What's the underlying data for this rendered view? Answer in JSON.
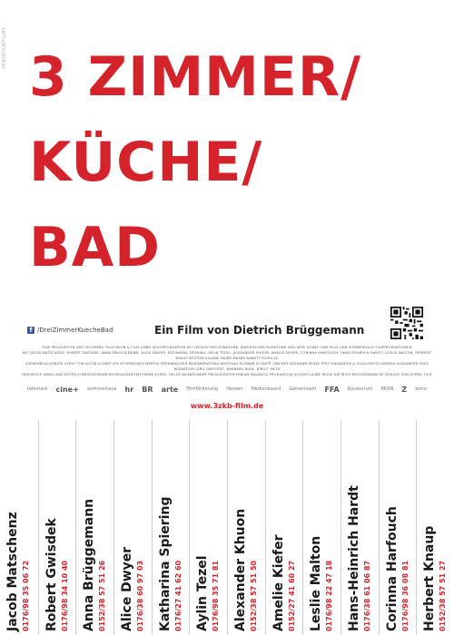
{
  "side_label": "ZEROFILMFILMS",
  "title_lines": [
    "3 ZIMMER/",
    "KÜCHE/",
    "BAD"
  ],
  "facebook": "/DreiZimmerKuecheBad",
  "subtitle": "Ein Film von Dietrich Brüggemann",
  "credits": [
    "EINE PRODUKTION DER TELEMARK TELEVISION & FILM GMBH IN KOPRODUKTION MIT HESSISCHER RUNDFUNK, BAYERISCHER RUNDFUNK UND ARTE SOWIE CINE PLUS UND SOMMERHAUS FILMPRODUKTIONEN",
    "MIT JACOB MATSCHENZ, ROBERT GWISDEK, ANNA BRÜGGEMANN, ALICE DWYER, KATHARINA SPIERING, AYLIN TEZEL, ALEXANDER KHUON, AMELIE KIEFER, CORINNA HARFOUCH, HANS-HEINRICH HARDT, LESLIE MALTON, HERBERT KNAUP KOSTÜM JULIANE MAIER MASKE ANNETT SCHULZE",
    "SZENENBILD KONSTA SYRIG TON JACOB ILGNER VFX STORYBOARD MARTIN FRÖHNBACHER MUSIKBERATUNG MATTHIAS SCHWAB SCHNITT VINCENT ASSMANN MUSIK PYRO RAGNARÖK & GUILLEMOTS KAMERA ALEXANDER SASS REDAKTION JÖRG HIMSTEDT, BARBARA BUHL, BIRGIT METZ",
    "DREHBUCH ANNA UND DIETRICH BRÜGGEMANN KOPRODUZENTEN FRANK EVERS, HELGE NEUBRONNER PRODUZENTEN FABIAN MAUBACH PRODUKTION JOCHEN LAUBE REGIE DIETRICH BRÜGGEMANN IM VERLEIH VON ZORRO FILM"
  ],
  "logos": [
    "telemark",
    "cine+",
    "sommerhaus",
    "hr",
    "BR",
    "arte",
    "Filmförderung",
    "Hessen",
    "Medienboard",
    "Gemeinsam",
    "FFA",
    "Kuratorium",
    "MOIN",
    "Z",
    "zorro"
  ],
  "url": "www.3zkb-film.de",
  "cast": [
    {
      "name": "Jacob Matschenz",
      "phone": "0176/98 35 06 72"
    },
    {
      "name": "Robert Gwisdek",
      "phone": "0176/98 34 10 40"
    },
    {
      "name": "Anna Brüggemann",
      "phone": "0152/38 57 51 26"
    },
    {
      "name": "Alice Dwyer",
      "phone": "0176/38 60 97 03"
    },
    {
      "name": "Katharina Spiering",
      "phone": "0176/27 41 62 60"
    },
    {
      "name": "Aylin Tezel",
      "phone": "0176/98 35 71 81"
    },
    {
      "name": "Alexander Khuon",
      "phone": "0152/38 57 51 50"
    },
    {
      "name": "Amelie Kiefer",
      "phone": "0152/27 41 60 27"
    },
    {
      "name": "Leslie Malton",
      "phone": "0176/98 22 47 18"
    },
    {
      "name": "Hans-Heinrich Hardt",
      "phone": "0176/38 61 06 87"
    },
    {
      "name": "Corinna Harfouch",
      "phone": "0176/98 36 08 81"
    },
    {
      "name": "Herbert Knaup",
      "phone": "0152/38 57 51 27"
    }
  ],
  "colors": {
    "accent": "#d4232a",
    "text": "#1a1a1a"
  }
}
